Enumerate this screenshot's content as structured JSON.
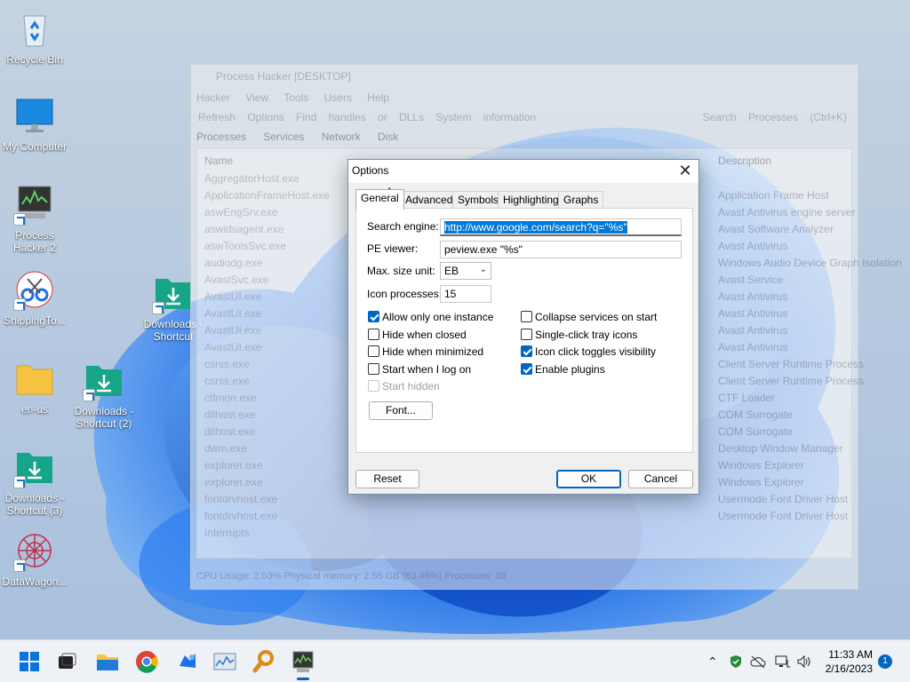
{
  "desktop": {
    "icons": [
      {
        "label": "Recycle Bin"
      },
      {
        "label": "My Computer"
      },
      {
        "label": "Process Hacker 2"
      },
      {
        "label": "SnippingTo..."
      },
      {
        "label": "en-us"
      },
      {
        "label": "DataWagon..."
      },
      {
        "label": "Downloads - Shortcut"
      },
      {
        "label": "Downloads - Shortcut (2)"
      },
      {
        "label": "Downloads - Shortcut (3)"
      }
    ]
  },
  "background_window": {
    "title": "Process Hacker [DESKTOP]",
    "menu": "Hacker View Tools Users Help",
    "toolbar": "Refresh Options Find handles or DLLs System information",
    "search_placeholder": "Search Processes (Ctrl+K)",
    "tabs": "Processes Services Network Disk",
    "col_name": "Name",
    "col_description": "Description",
    "rows": [
      "AggregatorHost.exe",
      "ApplicationFrameHost.exe",
      "aswEngSrv.exe",
      "aswidsagent.exe",
      "aswToolsSvc.exe",
      "audiodg.exe",
      "AvastSvc.exe",
      "AvastUI.exe",
      "AvastUI.exe",
      "AvastUI.exe",
      "AvastUI.exe",
      "csrss.exe",
      "csrss.exe",
      "ctfmon.exe",
      "dllhost.exe",
      "dllhost.exe",
      "dwm.exe",
      "explorer.exe",
      "explorer.exe",
      "fontdrvhost.exe",
      "fontdrvhost.exe",
      "Interrupts"
    ],
    "descriptions": [
      "Application Frame Host",
      "Avast Antivirus engine server",
      "Avast Software Analyzer",
      "Avast Antivirus",
      "Windows Audio Device Graph Isolation",
      "Avast Service",
      "Avast Antivirus",
      "Avast Antivirus",
      "Avast Antivirus",
      "Avast Antivirus",
      "Client Server Runtime Process",
      "Client Server Runtime Process",
      "CTF Loader",
      "COM Surrogate",
      "COM Surrogate",
      "Desktop Window Manager",
      "Windows Explorer",
      "Windows Explorer",
      "Usermode Font Driver Host",
      "Usermode Font Driver Host"
    ],
    "status": "CPU Usage: 2.03%   Physical memory: 2.55 GB (63.46%)   Processes: 89"
  },
  "dialog": {
    "title": "Options",
    "close_glyph": "✕",
    "tabs": [
      "General",
      "Advanced",
      "Symbols",
      "Highlighting",
      "Graphs"
    ],
    "active_tab": "General",
    "fields": {
      "search_engine_label": "Search engine:",
      "search_engine_value": "http://www.google.com/search?q=\"%s\"",
      "pe_viewer_label": "PE viewer:",
      "pe_viewer_value": "peview.exe \"%s\"",
      "max_size_label": "Max. size unit:",
      "max_size_value": "EB",
      "icon_processes_label": "Icon processes:",
      "icon_processes_value": "15"
    },
    "checkboxes_left": [
      {
        "label": "Allow only one instance",
        "checked": true
      },
      {
        "label": "Hide when closed",
        "checked": false
      },
      {
        "label": "Hide when minimized",
        "checked": false
      },
      {
        "label": "Start when I log on",
        "checked": false
      },
      {
        "label": "Start hidden",
        "checked": false,
        "disabled": true
      }
    ],
    "checkboxes_right": [
      {
        "label": "Collapse services on start",
        "checked": false
      },
      {
        "label": "Single-click tray icons",
        "checked": false
      },
      {
        "label": "Icon click toggles visibility",
        "checked": true
      },
      {
        "label": "Enable plugins",
        "checked": true
      }
    ],
    "font_button": "Font...",
    "reset_button": "Reset",
    "ok_button": "OK",
    "cancel_button": "Cancel"
  },
  "taskbar": {
    "apps": [
      "start-icon",
      "task-view-icon",
      "file-explorer-icon",
      "chrome-icon",
      "app-icon",
      "performance-monitor-icon",
      "magnifier-search-icon",
      "process-hacker-icon"
    ],
    "clock_time": "11:33 AM",
    "clock_date": "2/16/2023",
    "notification_count": "1"
  },
  "colors": {
    "accent": "#0067c0",
    "selection": "#0078d7",
    "wallpaper_blue": "#1a5fd0"
  }
}
